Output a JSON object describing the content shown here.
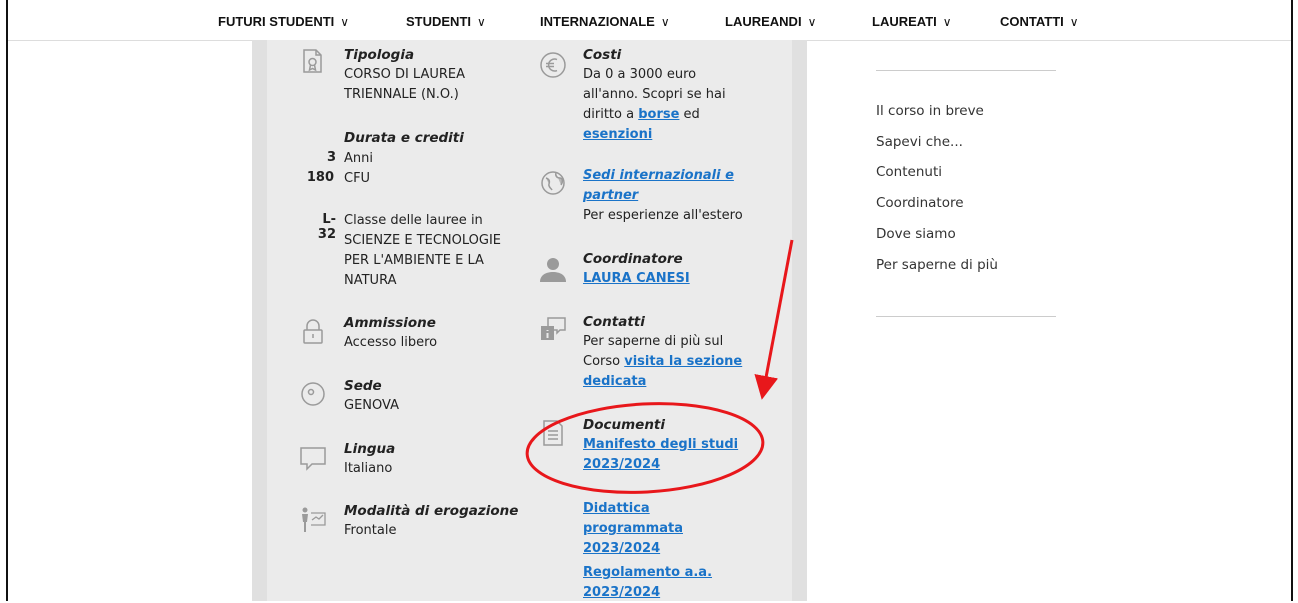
{
  "nav": {
    "items": [
      {
        "label": "FUTURI STUDENTI"
      },
      {
        "label": "STUDENTI"
      },
      {
        "label": "INTERNAZIONALE"
      },
      {
        "label": "LAUREANDI"
      },
      {
        "label": "LAUREATI"
      },
      {
        "label": "CONTATTI"
      }
    ],
    "chevron": "∨"
  },
  "left": {
    "tipologia": {
      "label": "Tipologia",
      "value": "CORSO DI LAUREA TRIENNALE (N.O.)"
    },
    "durata": {
      "label": "Durata e crediti",
      "years_num": "3",
      "years_unit": "Anni",
      "cfu_num": "180",
      "cfu_unit": "CFU"
    },
    "classe": {
      "code": "L-32",
      "value": "Classe delle lauree in SCIENZE E TECNOLOGIE PER L'AMBIENTE E LA NATURA"
    },
    "ammissione": {
      "label": "Ammissione",
      "value": "Accesso libero"
    },
    "sede": {
      "label": "Sede",
      "value": "GENOVA"
    },
    "lingua": {
      "label": "Lingua",
      "value": "Italiano"
    },
    "modalita": {
      "label": "Modalità di erogazione",
      "value": "Frontale"
    }
  },
  "right": {
    "costi": {
      "label": "Costi",
      "text1": "Da 0 a 3000 euro all'anno. Scopri se hai diritto a ",
      "link1": "borse",
      "text2": " ed ",
      "link2": "esenzioni"
    },
    "sedi": {
      "link": "Sedi internazionali e partner",
      "value": "Per esperienze all'estero"
    },
    "coordinatore": {
      "label": "Coordinatore",
      "link": "LAURA CANESI"
    },
    "contatti": {
      "label": "Contatti",
      "text": "Per saperne di più sul Corso ",
      "link": "visita la sezione dedicata"
    },
    "documenti": {
      "label": "Documenti",
      "links": [
        "Manifesto degli studi 2023/2024",
        "Didattica programmata 2023/2024",
        "Regolamento a.a. 2023/2024"
      ]
    }
  },
  "toc": {
    "items": [
      "Il corso in breve",
      "Sapevi che...",
      "Contenuti",
      "Coordinatore",
      "Dove siamo",
      "Per saperne di più"
    ]
  },
  "colors": {
    "link": "#1a73c8",
    "annotation": "#e8171b",
    "panel": "#ebebeb"
  }
}
